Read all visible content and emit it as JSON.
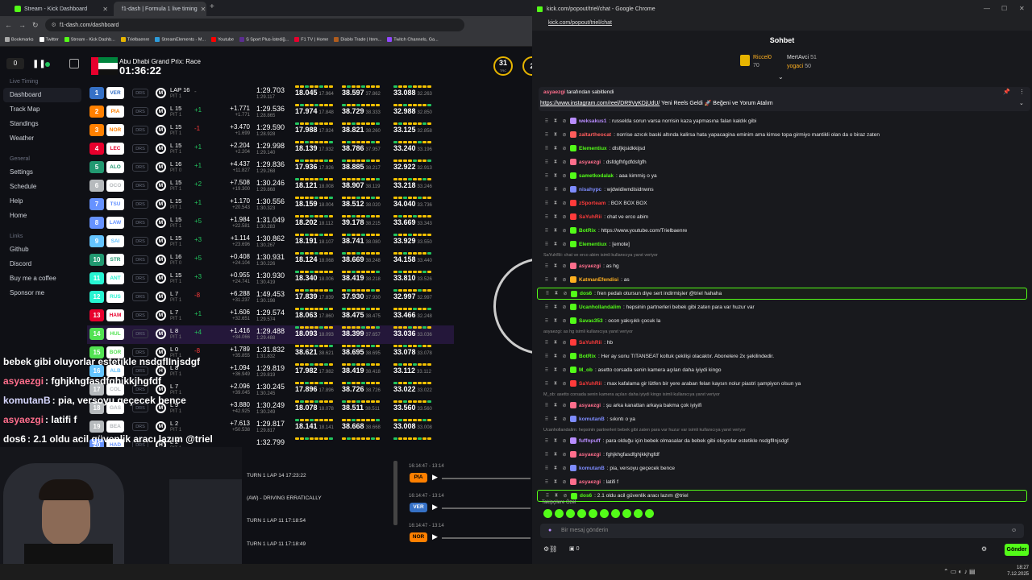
{
  "left_tabs": [
    {
      "label": "Stream - Kick Dashboard"
    },
    {
      "label": "f1-dash | Formula 1 live timing"
    }
  ],
  "left_url": "f1-dash.com/dashboard",
  "bookmarks": [
    "Bookmarks",
    "Twitter",
    "Stream - Kick Dashb...",
    "Trielbaenre",
    "StreamElements - M...",
    "Youtube",
    "S Sport Plus-İstediğ...",
    "F1 TV | Home",
    "Diablo Trade | Item...",
    "Twitch Channels, Ga..."
  ],
  "dash": {
    "race_name": "Abu Dhabi Grand Prix: Race",
    "race_clock": "01:36:22",
    "counter": "0",
    "track_temp": "31",
    "track_unit": "TRC",
    "air_temp": "2"
  },
  "sidebar": {
    "live_timing_heading": "Live Timing",
    "items_main": [
      "Dashboard",
      "Track Map",
      "Standings",
      "Weather"
    ],
    "general_heading": "General",
    "items_general": [
      "Settings",
      "Schedule",
      "Help",
      "Home"
    ],
    "links_heading": "Links",
    "items_links": [
      "Github",
      "Discord",
      "Buy me a coffee",
      "Sponsor me"
    ]
  },
  "drivers": [
    {
      "pos": "1",
      "code": "VER",
      "pos_color": "#3671c6",
      "lap": "LAP 16",
      "pit": "PIT 1",
      "delta": "-",
      "gap": "",
      "gap2": "",
      "time": "1:29.703",
      "time2": "1:29.117",
      "s1": "18.045",
      "s1b": "17.964",
      "s2": "38.597",
      "s2b": "37.862",
      "s3": "33.088",
      "s3b": "32.263"
    },
    {
      "pos": "2",
      "code": "PIA",
      "pos_color": "#ff8000",
      "lap": "L 15",
      "pit": "PIT 1",
      "delta": "+1",
      "gap": "+1.771",
      "gap2": "+1.771",
      "time": "1:29.536",
      "time2": "1:28.865",
      "s1": "17.974",
      "s1b": "17.848",
      "s2": "38.729",
      "s2b": "38.333",
      "s3": "32.988",
      "s3b": "32.850"
    },
    {
      "pos": "3",
      "code": "NOR",
      "pos_color": "#ff8000",
      "lap": "L 15",
      "pit": "PIT 1",
      "delta": "-1",
      "gap": "+3.470",
      "gap2": "+1.699",
      "time": "1:29.590",
      "time2": "1:28.928",
      "s1": "17.988",
      "s1b": "17.924",
      "s2": "38.821",
      "s2b": "38.260",
      "s3": "33.125",
      "s3b": "32.858"
    },
    {
      "pos": "4",
      "code": "LEC",
      "pos_color": "#e8002d",
      "lap": "L 15",
      "pit": "PIT 1",
      "delta": "+1",
      "gap": "+2.204",
      "gap2": "+2.204",
      "time": "1:29.998",
      "time2": "1:29.140",
      "s1": "18.139",
      "s1b": "17.932",
      "s2": "38.786",
      "s2b": "37.957",
      "s3": "33.240",
      "s3b": "33.196"
    },
    {
      "pos": "5",
      "code": "ALO",
      "pos_color": "#229971",
      "lap": "L 16",
      "pit": "PIT 0",
      "delta": "+1",
      "gap": "+4.437",
      "gap2": "+11.827",
      "time": "1:29.836",
      "time2": "1:29.268",
      "s1": "17.936",
      "s1b": "17.926",
      "s2": "38.885",
      "s2b": "38.217",
      "s3": "32.922",
      "s3b": "32.913"
    },
    {
      "pos": "6",
      "code": "OCO",
      "pos_color": "#b6babd",
      "lap": "L 15",
      "pit": "PIT 1",
      "delta": "+2",
      "gap": "+7.508",
      "gap2": "+19.300",
      "time": "1:30.246",
      "time2": "1:29.868",
      "s1": "18.121",
      "s1b": "18.008",
      "s2": "38.907",
      "s2b": "38.119",
      "s3": "33.218",
      "s3b": "33.246"
    },
    {
      "pos": "7",
      "code": "TSU",
      "pos_color": "#6692ff",
      "lap": "L 15",
      "pit": "PIT 1",
      "delta": "+1",
      "gap": "+1.170",
      "gap2": "+20.543",
      "time": "1:30.556",
      "time2": "1:30.323",
      "s1": "18.159",
      "s1b": "18.004",
      "s2": "38.512",
      "s2b": "38.020",
      "s3": "34.040",
      "s3b": "33.736"
    },
    {
      "pos": "8",
      "code": "LAW",
      "pos_color": "#6692ff",
      "lap": "L 15",
      "pit": "PIT 1",
      "delta": "+5",
      "gap": "+1.984",
      "gap2": "+22.581",
      "time": "1:31.049",
      "time2": "1:30.283",
      "s1": "18.202",
      "s1b": "18.112",
      "s2": "39.178",
      "s2b": "38.215",
      "s3": "33.669",
      "s3b": "33.343"
    },
    {
      "pos": "9",
      "code": "SAI",
      "pos_color": "#64c4ff",
      "lap": "L 15",
      "pit": "PIT 1",
      "delta": "+3",
      "gap": "+1.114",
      "gap2": "+23.696",
      "time": "1:30.862",
      "time2": "1:30.267",
      "s1": "18.191",
      "s1b": "18.107",
      "s2": "38.741",
      "s2b": "38.080",
      "s3": "33.929",
      "s3b": "33.550"
    },
    {
      "pos": "10",
      "code": "STR",
      "pos_color": "#229971",
      "lap": "L 16",
      "pit": "PIT 0",
      "delta": "+5",
      "gap": "+0.408",
      "gap2": "+24.104",
      "time": "1:30.931",
      "time2": "1:30.226",
      "s1": "18.124",
      "s1b": "18.068",
      "s2": "38.669",
      "s2b": "38.248",
      "s3": "34.158",
      "s3b": "33.440"
    },
    {
      "pos": "11",
      "code": "ANT",
      "pos_color": "#27f4d2",
      "lap": "L 15",
      "pit": "PIT 1",
      "delta": "+3",
      "gap": "+0.955",
      "gap2": "+24.741",
      "time": "1:30.930",
      "time2": "1:30.419",
      "s1": "18.340",
      "s1b": "18.006",
      "s2": "38.419",
      "s2b": "38.218",
      "s3": "33.810",
      "s3b": "33.526"
    },
    {
      "pos": "12",
      "code": "RUS",
      "pos_color": "#27f4d2",
      "lap": "L 7",
      "pit": "PIT 1",
      "delta": "-8",
      "gap": "+6.288",
      "gap2": "+31.237",
      "time": "1:49.453",
      "time2": "1:30.198",
      "s1": "17.839",
      "s1b": "17.839",
      "s2": "37.930",
      "s2b": "37.930",
      "s3": "32.997",
      "s3b": "32.997"
    },
    {
      "pos": "13",
      "code": "HAM",
      "pos_color": "#e8002d",
      "lap": "L 7",
      "pit": "PIT 1",
      "delta": "+1",
      "gap": "+1.606",
      "gap2": "+32.651",
      "time": "1:29.574",
      "time2": "1:29.574",
      "s1": "18.063",
      "s1b": "17.860",
      "s2": "38.475",
      "s2b": "38.475",
      "s3": "33.466",
      "s3b": "32.248"
    },
    {
      "pos": "14",
      "code": "HUL",
      "pos_color": "#52e252",
      "lap": "L 8",
      "pit": "PIT 1",
      "delta": "+4",
      "gap": "+1.416",
      "gap2": "+34.066",
      "time": "1:29.488",
      "time2": "1:29.488",
      "s1": "18.093",
      "s1b": "18.093",
      "s2": "38.399",
      "s2b": "37.657",
      "s3": "33.036",
      "s3b": "33.036"
    },
    {
      "pos": "15",
      "code": "BOR",
      "pos_color": "#52e252",
      "lap": "L 0",
      "pit": "PIT 1",
      "delta": "-8",
      "gap": "+1.789",
      "gap2": "+35.855",
      "time": "1:31.832",
      "time2": "1:31.832",
      "s1": "38.621",
      "s1b": "38.621",
      "s2": "38.695",
      "s2b": "38.695",
      "s3": "33.078",
      "s3b": "33.078"
    },
    {
      "pos": "16",
      "code": "ALB",
      "pos_color": "#64c4ff",
      "lap": "L 8",
      "pit": "PIT 1",
      "delta": "",
      "gap": "+1.094",
      "gap2": "+36.949",
      "time": "1:29.819",
      "time2": "1:29.819",
      "s1": "17.982",
      "s1b": "17.982",
      "s2": "38.419",
      "s2b": "38.418",
      "s3": "33.112",
      "s3b": "33.112"
    },
    {
      "pos": "17",
      "code": "COL",
      "pos_color": "#b6babd",
      "lap": "L 7",
      "pit": "PIT 1",
      "delta": "",
      "gap": "+2.096",
      "gap2": "+39.045",
      "time": "1:30.245",
      "time2": "1:30.245",
      "s1": "17.896",
      "s1b": "17.896",
      "s2": "38.726",
      "s2b": "38.726",
      "s3": "33.022",
      "s3b": "33.022"
    },
    {
      "pos": "18",
      "code": "GAS",
      "pos_color": "#b6babd",
      "lap": "L 9",
      "pit": "PIT 1",
      "delta": "",
      "gap": "+3.880",
      "gap2": "+42.925",
      "time": "1:30.249",
      "time2": "1:30.249",
      "s1": "18.078",
      "s1b": "18.078",
      "s2": "38.511",
      "s2b": "38.511",
      "s3": "33.560",
      "s3b": "33.560"
    },
    {
      "pos": "19",
      "code": "BEA",
      "pos_color": "#b6babd",
      "lap": "L 2",
      "pit": "PIT 1",
      "delta": "",
      "gap": "+7.613",
      "gap2": "+50.538",
      "time": "1:29.817",
      "time2": "1:29.817",
      "s1": "18.141",
      "s1b": "18.141",
      "s2": "38.668",
      "s2b": "38.668",
      "s3": "33.008",
      "s3b": "33.008"
    },
    {
      "pos": "20",
      "code": "HAD",
      "pos_color": "#6692ff",
      "lap": "L 2",
      "pit": "PIT 1",
      "delta": "",
      "gap": "",
      "gap2": "",
      "time": "1:32.799",
      "time2": "",
      "s1": "",
      "s1b": "",
      "s2": "",
      "s2b": "",
      "s3": "",
      "s3b": ""
    }
  ],
  "events": [
    {
      "text": "TURN 1 LAP 14 17:23:22"
    },
    {
      "text": "(AW) - DRIVING ERRATICALLY"
    },
    {
      "text": "TURN 1 LAP 11 17:18:54"
    },
    {
      "text": "TURN 1 LAP 11 17:18:49"
    }
  ],
  "radio": [
    {
      "time": "16:14:47 - 13:14",
      "code": "PIA",
      "color": "#ff8000"
    },
    {
      "time": "16:14:47 - 13:14",
      "code": "VER",
      "color": "#3671c6"
    },
    {
      "time": "16:14:47 - 13:14",
      "code": "NOR",
      "color": "#ff8000"
    }
  ],
  "overlay_chat": [
    {
      "user": "",
      "text": "bebek gibi oluyorlar estetikle nsdgflInjsdgf"
    },
    {
      "user": "asyaezgi",
      "text": ": fghjkhgfasdfghjkkjhgfdf"
    },
    {
      "user": "komutanB",
      "text": ": pia, versoyu geçecek bence"
    },
    {
      "user": "asyaezgi",
      "text": ": latifi f"
    },
    {
      "user": "dos6",
      "text": ": 2.1 oldu acil güvenlik aracı lazım @triel"
    }
  ],
  "chat_window": {
    "title": "kick.com/popout/triel/chat - Google Chrome",
    "url": "kick.com/popout/triel/chat",
    "header": "Sohbet",
    "leaderboard": [
      {
        "name": "Riccel0",
        "points": "70"
      },
      {
        "name": "MertAvci",
        "points": "51"
      },
      {
        "name": "yogaci",
        "points": "50"
      }
    ],
    "pinned_user": "asyaezgi",
    "pinned_by": "tarafından sabitlendi",
    "pinned_link": "https://www.instagram.com/reel/DR9VyKDjUdU/",
    "pinned_text": "Yeni Reels Geldi 🚀 Beğeni ve Yorum Atalım",
    "input_placeholder": "Bir mesaj gönderin",
    "send_label": "Gönder",
    "followers_label": "Takipçilere Özel",
    "viewer_count": "0"
  },
  "chat_messages": [
    {
      "user": "weksakus1",
      "color": "#b98dff",
      "text": ": russelda sorun varsa norrisin kaza yapmasına falan kaldık gibi"
    },
    {
      "user": "zaltartheocat",
      "color": "#ff5c5c",
      "text": ": norrise azıcık baski altında kalirsa hata yapacagina eminim ama kimse topa girmiyo mantikli olan da o biraz zaten"
    },
    {
      "user": "Elementiux",
      "color": "#53fc18",
      "text": ": dlsfjkjsidkkijsd"
    },
    {
      "user": "asyaezgi",
      "color": "#ff6e8c",
      "text": ": dsfdgfhfgdfdsfgfh"
    },
    {
      "user": "sametkodalak",
      "color": "#53fc18",
      "text": ": aaa kimmiş o ya"
    },
    {
      "user": "nisahypc",
      "color": "#7e8cff",
      "text": ": wjdwidiwndisidnwns"
    },
    {
      "user": "zSporteam",
      "color": "#ff3b3b",
      "text": ": BOX BOX BOX"
    },
    {
      "user": "SaYuhRii",
      "color": "#ff3b3b",
      "text": ": chat ve erco abim"
    },
    {
      "user": "BotRix",
      "color": "#53fc18",
      "text": ": https://www.youtube.com/Trielbaenre"
    },
    {
      "user": "Elementiux",
      "color": "#53fc18",
      "text": ": [emote]"
    },
    {
      "user": "asyaezgi",
      "color": "#ff6e8c",
      "text": ": as hg"
    },
    {
      "user": "KatmanEfendisi",
      "color": "#ffb020",
      "text": ": as"
    },
    {
      "user": "dos6",
      "color": "#53fc18",
      "text": ": fren pedalı otursun diye sert indirmişler @triel hahaha"
    },
    {
      "user": "Ucanhollandalim",
      "color": "#53fc18",
      "text": ": hepsinin partnerleri bebek gibi zaten para var huzur var"
    },
    {
      "user": "Savas353",
      "color": "#53fc18",
      "text": ": ocon yakışıklı çocuk la"
    },
    {
      "user": "SaYuhRii",
      "color": "#ff3b3b",
      "text": ": hb"
    },
    {
      "user": "BotRix",
      "color": "#53fc18",
      "text": ": Her ay sonu TITANSEAT koltuk çekilişi olacaktır. Abonelere 2x şekilindedir."
    },
    {
      "user": "M_ob",
      "color": "#53fc18",
      "text": ": asetto corsada senin kamera açıları daha iyiydi kingo"
    },
    {
      "user": "SaYuhRii",
      "color": "#ff3b3b",
      "text": ": max kafalama gir lütfen bir yere araban felan kaysın nolur piastri şampiyon olsun ya"
    },
    {
      "user": "asyaezgi",
      "color": "#ff6e8c",
      "text": ": şu arka kanattan arkaya bakma çok iyiyifi"
    },
    {
      "user": "komutanB",
      "color": "#7e8cff",
      "text": ": sıkıntı o ya"
    },
    {
      "user": "fuffnpuff",
      "color": "#b98dff",
      "text": ": para olduğu için bebek olmasalar da bebek gibi oluyorlar estetikle nsdgflInjsdgf"
    },
    {
      "user": "asyaezgi",
      "color": "#ff6e8c",
      "text": ": fghjkhgfasdfghjkkjhgfdf"
    },
    {
      "user": "komutanB",
      "color": "#7e8cff",
      "text": ": pia, versoyu geçecek bence"
    },
    {
      "user": "asyaezgi",
      "color": "#ff6e8c",
      "text": ": latifi f"
    },
    {
      "user": "dos6",
      "color": "#53fc18",
      "text": ": 2.1 oldu acil güvenlik aracı lazım @triel"
    }
  ],
  "reply_lines": [
    "SaYuhRii: chat ve erco abim isimli kullanıcıya yanıt veriyor",
    "asyaezgi: as hg isimli kullanıcıya yanıt veriyor",
    "M_ob: asetto corsada senin kamera açıları daha iyiydi kingo isimli kullanıcıya yanıt veriyor",
    "Ucanhollandalim: hepsinin partnerleri bebek gibi zaten para var huzur var isimli kullanıcıya yanıt veriyor"
  ],
  "taskbar": {
    "time": "18:27",
    "date": "7.12.2025"
  }
}
